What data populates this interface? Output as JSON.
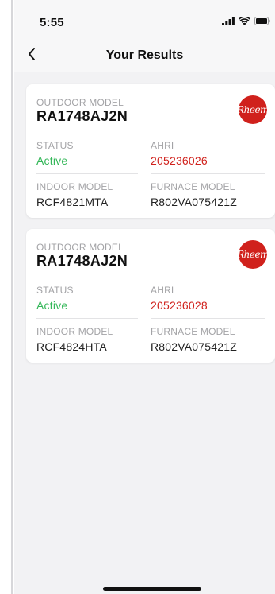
{
  "status_bar": {
    "time": "5:55",
    "icons": [
      "cellular-signal-icon",
      "wifi-icon",
      "battery-icon"
    ]
  },
  "nav": {
    "back_icon": "chevron-left-icon",
    "title": "Your Results"
  },
  "colors": {
    "status_active": "#34b759",
    "ahri_value": "#d0211c",
    "brand_logo": "#d0211c"
  },
  "results": [
    {
      "outdoor_model_label": "OUTDOOR MODEL",
      "outdoor_model": "RA1748AJ2N",
      "brand_logo_text": "Rheem",
      "status_label": "STATUS",
      "status": "Active",
      "ahri_label": "AHRI",
      "ahri": "205236026",
      "indoor_model_label": "INDOOR MODEL",
      "indoor_model": "RCF4821MTA",
      "furnace_model_label": "FURNACE MODEL",
      "furnace_model": "R802VA075421Z"
    },
    {
      "outdoor_model_label": "OUTDOOR MODEL",
      "outdoor_model": "RA1748AJ2N",
      "brand_logo_text": "Rheem",
      "status_label": "STATUS",
      "status": "Active",
      "ahri_label": "AHRI",
      "ahri": "205236028",
      "indoor_model_label": "INDOOR MODEL",
      "indoor_model": "RCF4824HTA",
      "furnace_model_label": "FURNACE MODEL",
      "furnace_model": "R802VA075421Z"
    }
  ]
}
